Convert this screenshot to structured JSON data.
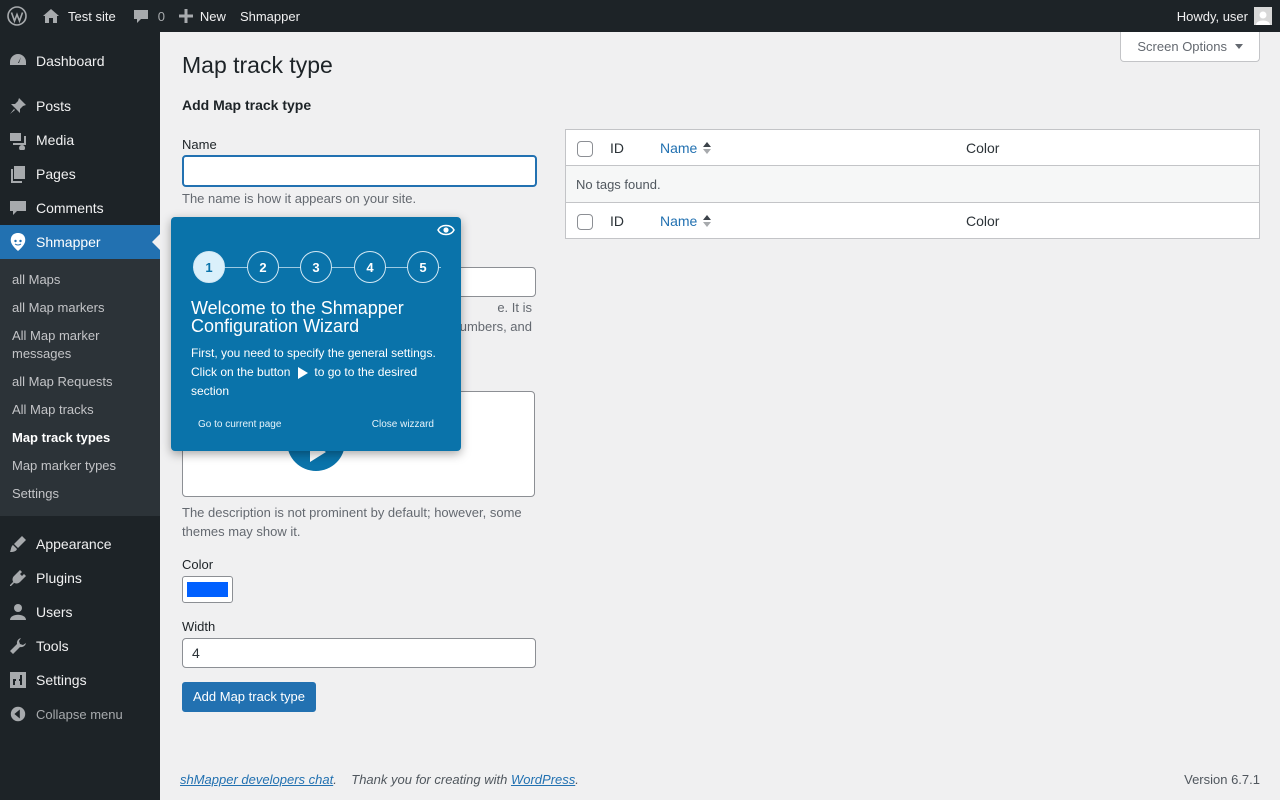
{
  "adminbar": {
    "site_name": "Test site",
    "comments_count": "0",
    "new_label": "New",
    "plugin_label": "Shmapper",
    "howdy": "Howdy, user"
  },
  "sidebar": {
    "items": [
      {
        "label": "Dashboard",
        "icon": "dashboard-icon"
      },
      {
        "label": "Posts",
        "icon": "pin-icon"
      },
      {
        "label": "Media",
        "icon": "media-icon"
      },
      {
        "label": "Pages",
        "icon": "pages-icon"
      },
      {
        "label": "Comments",
        "icon": "comment-icon"
      },
      {
        "label": "Shmapper",
        "icon": "shmapper-icon"
      }
    ],
    "submenu": [
      "all Maps",
      "all Map markers",
      "All Map marker messages",
      "all Map Requests",
      "All Map tracks",
      "Map track types",
      "Map marker types",
      "Settings"
    ],
    "items2": [
      {
        "label": "Appearance",
        "icon": "brush-icon"
      },
      {
        "label": "Plugins",
        "icon": "plugin-icon"
      },
      {
        "label": "Users",
        "icon": "user-icon"
      },
      {
        "label": "Tools",
        "icon": "wrench-icon"
      },
      {
        "label": "Settings",
        "icon": "settings-icon"
      }
    ],
    "collapse_label": "Collapse menu"
  },
  "screen_options": "Screen Options",
  "page_title": "Map track type",
  "form": {
    "heading": "Add Map track type",
    "name_label": "Name",
    "name_value": "",
    "name_desc": "The name is how it appears on your site.",
    "slug_desc_visible": "e. It is",
    "slug_desc_visible2": "umbers, and",
    "description_desc": "The description is not prominent by default; however, some themes may show it.",
    "color_label": "Color",
    "color_value": "#0060ff",
    "width_label": "Width",
    "width_value": "4",
    "submit_label": "Add Map track type"
  },
  "table": {
    "columns": [
      "ID",
      "Name",
      "Color"
    ],
    "empty_text": "No tags found."
  },
  "wizard": {
    "steps": [
      "1",
      "2",
      "3",
      "4",
      "5"
    ],
    "active_step": 1,
    "title": "Welcome to the Shmapper Configuration Wizard",
    "text_before": "First, you need to specify the general settings. Click on the button",
    "text_after": "to go to the desired section",
    "go_link": "Go to current page",
    "close_link": "Close wizzard"
  },
  "footer": {
    "chat_link": "shMapper developers chat",
    "thanks_before": "Thank you for creating with",
    "wp_link": "WordPress",
    "version": "Version 6.7.1"
  }
}
